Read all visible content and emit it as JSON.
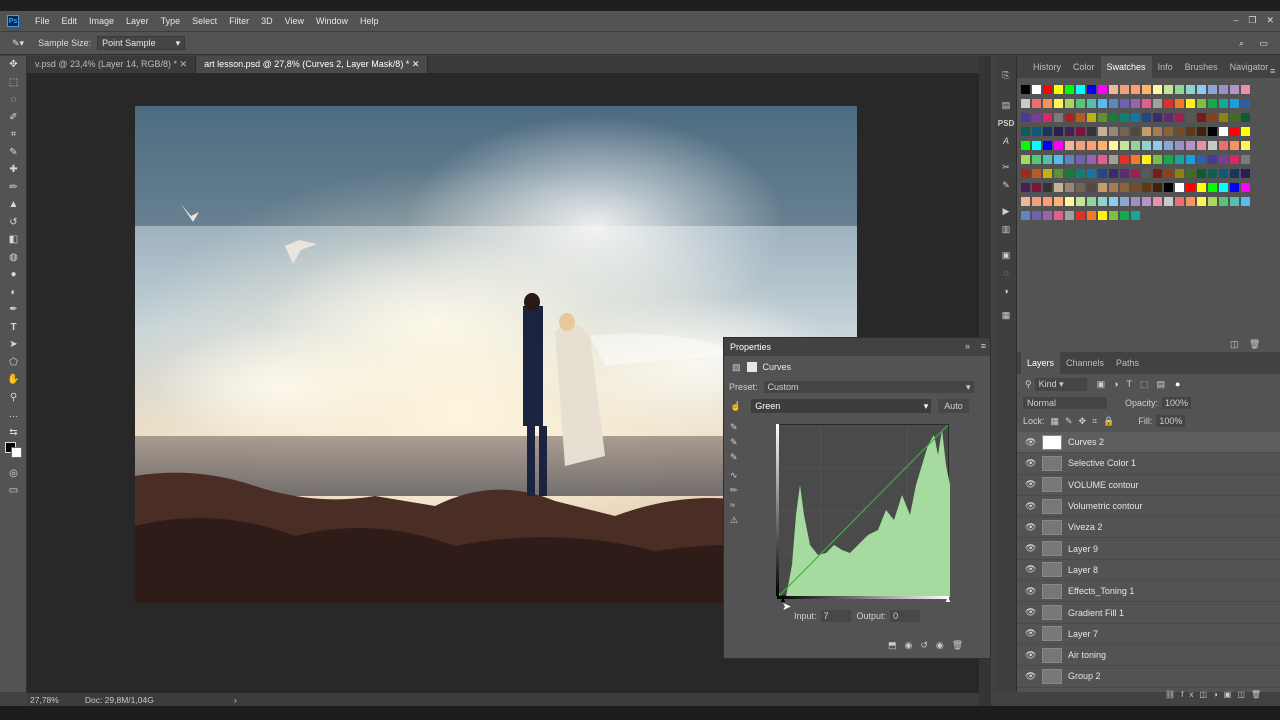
{
  "menu": [
    "File",
    "Edit",
    "Image",
    "Layer",
    "Type",
    "Select",
    "Filter",
    "3D",
    "View",
    "Window",
    "Help"
  ],
  "options": {
    "label": "Sample Size:",
    "value": "Point Sample"
  },
  "tabs": [
    {
      "label": "v.psd @ 23,4% (Layer 14, RGB/8) *"
    },
    {
      "label": "art lesson.psd @ 27,8% (Curves 2, Layer Mask/8) *"
    }
  ],
  "status": {
    "zoom": "27,78%",
    "doc": "Doc: 29,8M/1,04G"
  },
  "swatch_tabs": [
    "History",
    "Color",
    "Swatches",
    "Info",
    "Brushes",
    "Navigator"
  ],
  "layers_tabs": [
    "Layers",
    "Channels",
    "Paths"
  ],
  "layer_controls": {
    "kind": "Kind",
    "blend": "Normal",
    "opacity_label": "Opacity:",
    "opacity": "100%",
    "lock_label": "Lock:",
    "fill_label": "Fill:",
    "fill": "100%"
  },
  "layers": [
    "Curves 2",
    "Selective Color 1",
    "VOLUME contour",
    "Volumetric contour",
    "Viveza 2",
    "Layer 9",
    "Layer 8",
    "Effects_Toning 1",
    "Gradient Fill 1",
    "Layer 7",
    "Air toning",
    "Group 2"
  ],
  "properties": {
    "title": "Properties",
    "adjustment": "Curves",
    "preset_label": "Preset:",
    "preset": "Custom",
    "channel": "Green",
    "auto": "Auto",
    "input_label": "Input:",
    "input": "7",
    "output_label": "Output:",
    "output": "0"
  },
  "colors": {
    "accent": "#ffffff",
    "histogram": "#a6dba0",
    "curve": "#3fae3f"
  }
}
